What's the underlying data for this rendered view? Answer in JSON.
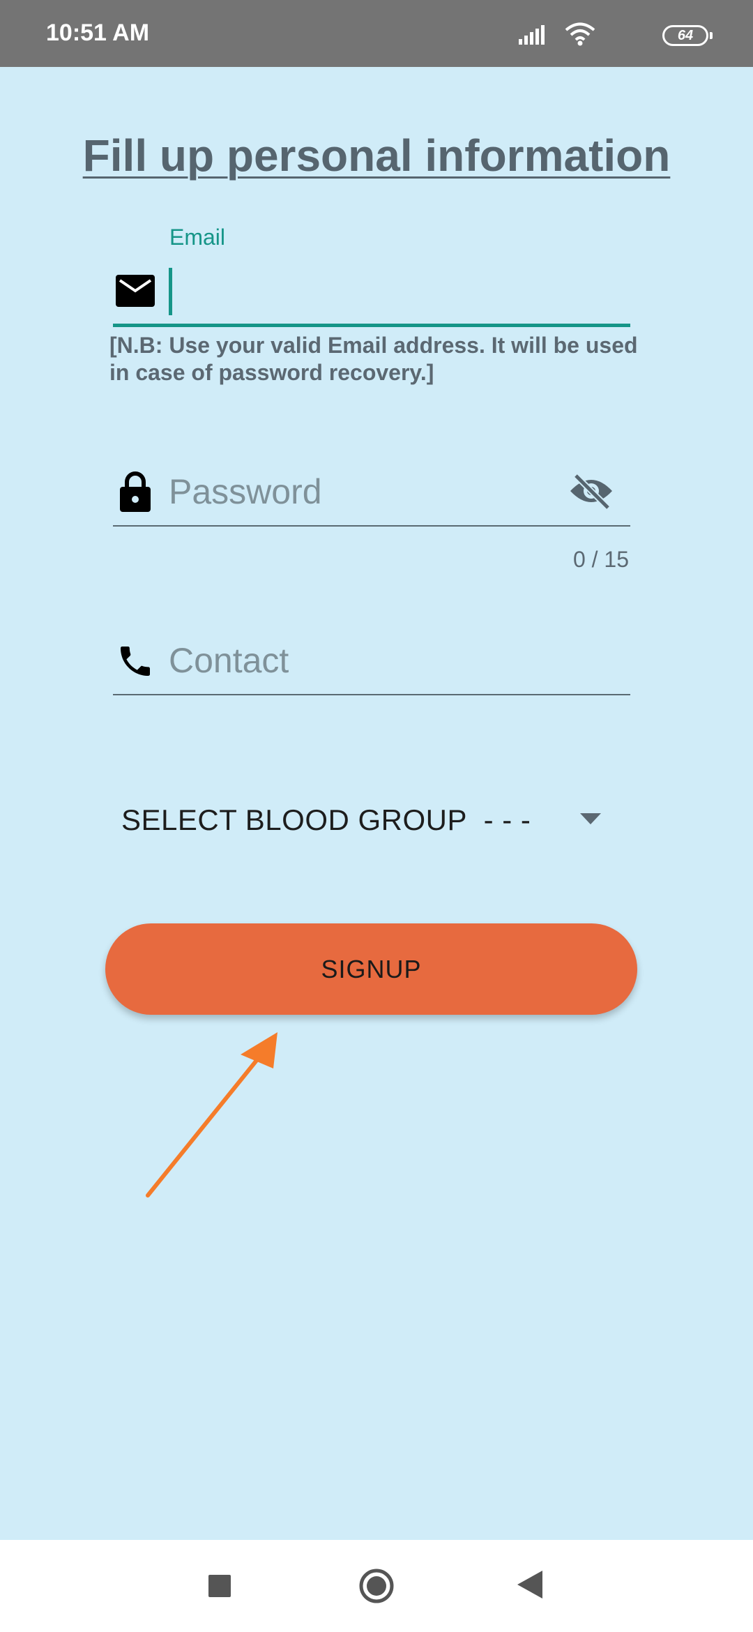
{
  "status_bar": {
    "time": "10:51 AM",
    "battery_level": "64"
  },
  "page": {
    "title": "Fill up personal information"
  },
  "email": {
    "label": "Email",
    "value": "",
    "note": "[N.B: Use your valid Email address. It will be used in case of password recovery.]",
    "icon": "email-icon",
    "accent_color": "#159588"
  },
  "password": {
    "placeholder": "Password",
    "counter": "0 / 15",
    "icon": "lock-icon",
    "toggle_icon": "visibility-off-icon"
  },
  "contact": {
    "placeholder": "Contact",
    "icon": "phone-icon"
  },
  "blood_group": {
    "selected": "SELECT BLOOD GROUP  - - -",
    "icon": "dropdown-arrow-icon"
  },
  "signup": {
    "label": "SIGNUP",
    "color": "#e76a3f"
  },
  "colors": {
    "background": "#d0ecf8",
    "status_bar": "#747474",
    "annotation_arrow": "#f57c2a"
  },
  "nav_bar": {
    "icons": [
      "recents-icon",
      "home-icon",
      "back-icon"
    ]
  }
}
